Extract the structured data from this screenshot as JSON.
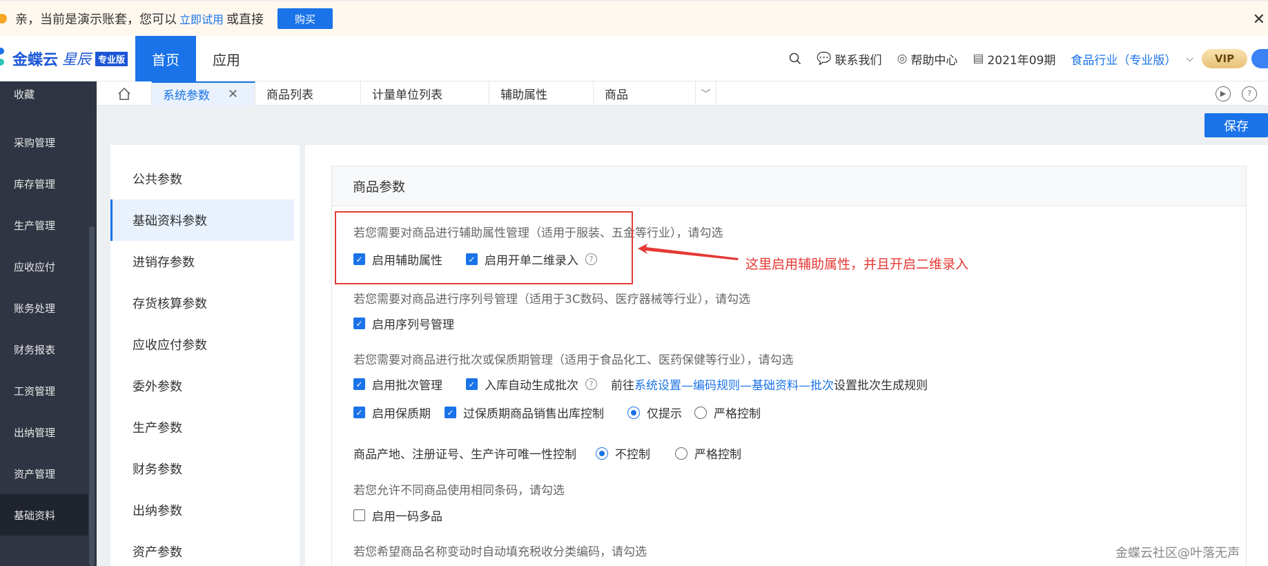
{
  "notice": {
    "text_before": "亲，当前是演示账套，您可以",
    "try_link": "立即试用",
    "text_after": "或直接",
    "buy_label": "购买",
    "close_glyph": "✕"
  },
  "header": {
    "brand": "金蝶云",
    "product": "星辰",
    "edition": "专业版",
    "nav": {
      "home": "首页",
      "app": "应用"
    },
    "contact": "联系我们",
    "help": "帮助中心",
    "period": "2021年09期",
    "industry": "食品行业（专业版）",
    "vip": "VIP"
  },
  "sidebar": {
    "items": [
      {
        "label": "收藏"
      },
      {
        "label": "采购管理"
      },
      {
        "label": "库存管理"
      },
      {
        "label": "生产管理"
      },
      {
        "label": "应收应付"
      },
      {
        "label": "账务处理"
      },
      {
        "label": "财务报表"
      },
      {
        "label": "工资管理"
      },
      {
        "label": "出纳管理"
      },
      {
        "label": "资产管理"
      },
      {
        "label": "基础资料"
      }
    ]
  },
  "tabs": {
    "items": [
      {
        "label": "系统参数",
        "active": true
      },
      {
        "label": "商品列表"
      },
      {
        "label": "计量单位列表"
      },
      {
        "label": "辅助属性"
      },
      {
        "label": "商品"
      }
    ],
    "close_glyph": "✕"
  },
  "toolbar": {
    "save_label": "保存"
  },
  "subnav": {
    "items": [
      {
        "label": "公共参数"
      },
      {
        "label": "基础资料参数",
        "active": true
      },
      {
        "label": "进销存参数"
      },
      {
        "label": "存货核算参数"
      },
      {
        "label": "应收应付参数"
      },
      {
        "label": "委外参数"
      },
      {
        "label": "生产参数"
      },
      {
        "label": "财务参数"
      },
      {
        "label": "出纳参数"
      },
      {
        "label": "资产参数"
      }
    ]
  },
  "panel": {
    "title": "商品参数",
    "aux_hint": "若您需要对商品进行辅助属性管理（适用于服装、五金等行业），请勾选",
    "aux_enable": "启用辅助属性",
    "aux_2d": "启用开单二维录入",
    "serial_hint": "若您需要对商品进行序列号管理（适用于3C数码、医疗器械等行业），请勾选",
    "serial_enable": "启用序列号管理",
    "batch_hint": "若您需要对商品进行批次或保质期管理（适用于食品化工、医药保健等行业），请勾选",
    "batch_enable": "启用批次管理",
    "batch_auto": "入库自动生成批次",
    "goto_prefix": "前往",
    "goto_link": "系统设置—编码规则—基础资料—批次",
    "goto_suffix": "设置批次生成规则",
    "shelf_enable": "启用保质期",
    "shelf_control": "过保质期商品销售出库控制",
    "shelf_opt1": "仅提示",
    "shelf_opt2": "严格控制",
    "origin_label": "商品产地、注册证号、生产许可唯一性控制",
    "origin_opt1": "不控制",
    "origin_opt2": "严格控制",
    "barcode_hint": "若您允许不同商品使用相同条码，请勾选",
    "barcode_enable": "启用一码多品",
    "tax_hint": "若您希望商品名称变动时自动填充税收分类编码，请勾选"
  },
  "annotation": "这里启用辅助属性，并且开启二维录入",
  "watermark": "金蝶云社区@叶落无声",
  "colors": {
    "accent": "#1a73e8",
    "sidebar": "#2f3542",
    "annotation": "#e53935"
  }
}
